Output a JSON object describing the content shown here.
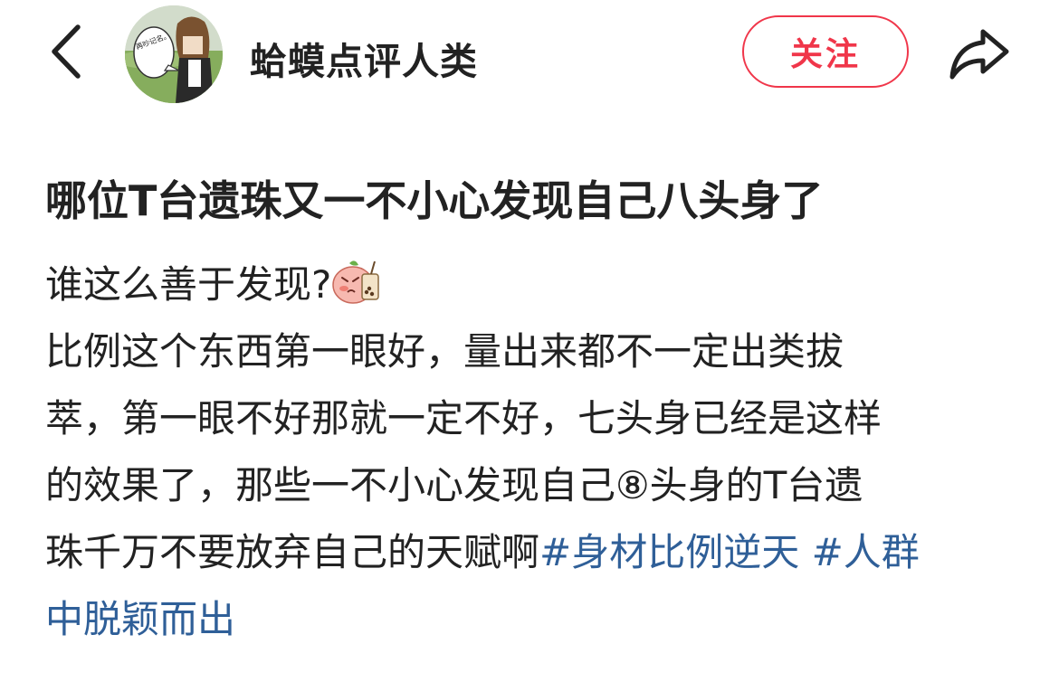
{
  "header": {
    "back_icon": "chevron-left-icon",
    "avatar_text": "再吵记名。",
    "author_name": "蛤蟆点评人类",
    "follow_label": "关注",
    "share_icon": "share-arrow-icon"
  },
  "post": {
    "title": "哪位T台遗珠又一不小心发现自己八头身了",
    "line1": "谁这么善于发现?",
    "emoji": "piggy-bubble-tea-sticker",
    "line2": "比例这个东西第一眼好，量出来都不一定出类拔",
    "line3": "萃，第一眼不好那就一定不好，七头身已经是这样",
    "line4": "的效果了，那些一不小心发现自己⑧头身的T台遗",
    "line5_text": "珠千万不要放弃自己的天赋啊",
    "hashtag1": "#身材比例逆天",
    "hashtag2_part1": "#人群",
    "hashtag2_part2": "中脱颖而出"
  },
  "colors": {
    "accent_red": "#f0364a",
    "hashtag_blue": "#2f5f98",
    "text": "#222222"
  }
}
